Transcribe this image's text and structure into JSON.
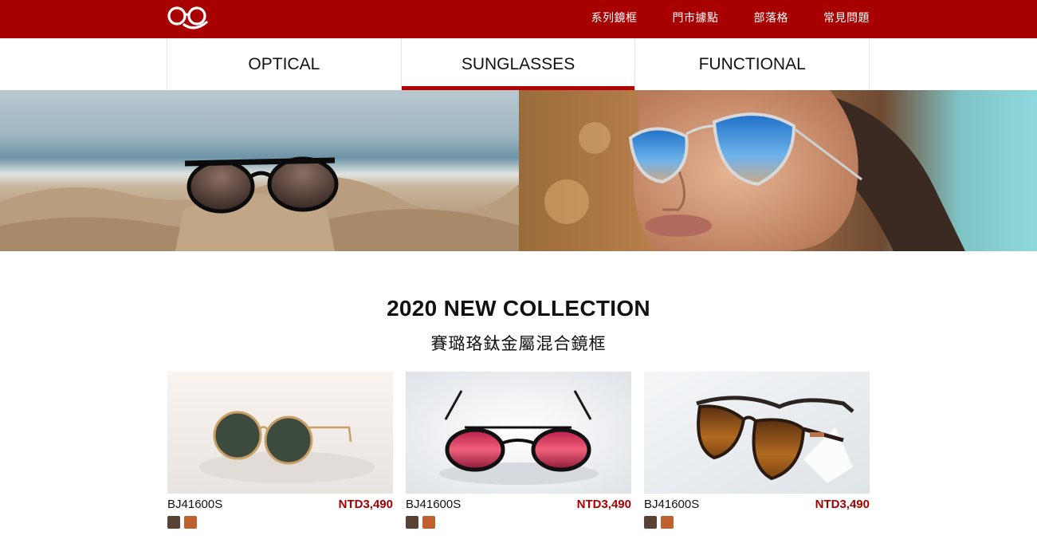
{
  "brand": {
    "logo_icon": "glasses-logo-icon",
    "accent": "#a80000"
  },
  "topnav": [
    {
      "label": "系列鏡框"
    },
    {
      "label": "門市據點"
    },
    {
      "label": "部落格"
    },
    {
      "label": "常見問題"
    }
  ],
  "tabs": [
    {
      "label": "OPTICAL",
      "active": false
    },
    {
      "label": "SUNGLASSES",
      "active": true
    },
    {
      "label": "FUNCTIONAL",
      "active": false
    }
  ],
  "collection": {
    "title": "2020 NEW COLLECTION",
    "subtitle": "賽璐珞鈦金屬混合鏡框"
  },
  "products": [
    {
      "name": "BJ41600S",
      "price": "NTD3,490",
      "swatches": [
        "#5a4135",
        "#c0602e"
      ]
    },
    {
      "name": "BJ41600S",
      "price": "NTD3,490",
      "swatches": [
        "#5a4135",
        "#c0602e"
      ]
    },
    {
      "name": "BJ41600S",
      "price": "NTD3,490",
      "swatches": [
        "#5a4135",
        "#c0602e"
      ]
    }
  ]
}
